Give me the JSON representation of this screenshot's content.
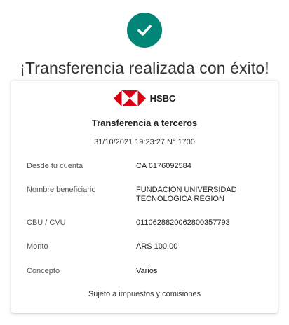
{
  "headline": "¡Transferencia realizada con éxito!",
  "colors": {
    "success": "#008577",
    "brand_red": "#db0011"
  },
  "icons": {
    "success": "checkmark-icon",
    "brand": "hsbc-hexagon-logo"
  },
  "card": {
    "brand": "HSBC",
    "title": "Transferencia a terceros",
    "meta": "31/10/2021 19:23:27 N° 1700",
    "rows": [
      {
        "label": "Desde tu cuenta",
        "value": "CA 6176092584"
      },
      {
        "label": "Nombre beneficiario",
        "value": "FUNDACION UNIVERSIDAD\nTECNOLOGICA REGION"
      },
      {
        "label": "CBU / CVU",
        "value": "0110628820062800357793"
      },
      {
        "label": "Monto",
        "value": "ARS 100,00"
      },
      {
        "label": "Concepto",
        "value": "Varios"
      }
    ],
    "footer": "Sujeto a impuestos y comisiones"
  }
}
